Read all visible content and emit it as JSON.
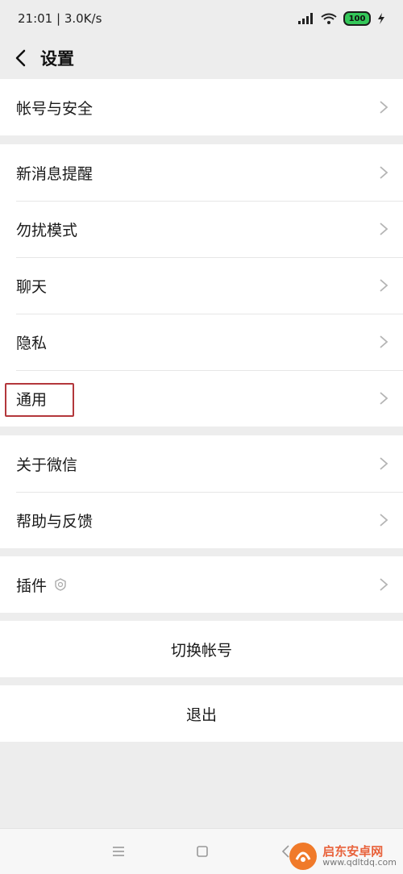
{
  "status": {
    "time_speed": "21:01 | 3.0K/s",
    "battery": "100"
  },
  "header": {
    "title": "设置"
  },
  "groups": [
    {
      "items": [
        {
          "label": "帐号与安全"
        }
      ]
    },
    {
      "items": [
        {
          "label": "新消息提醒"
        },
        {
          "label": "勿扰模式"
        },
        {
          "label": "聊天"
        },
        {
          "label": "隐私"
        },
        {
          "label": "通用"
        }
      ]
    },
    {
      "items": [
        {
          "label": "关于微信"
        },
        {
          "label": "帮助与反馈"
        }
      ]
    },
    {
      "items": [
        {
          "label": "插件"
        }
      ]
    }
  ],
  "actions": {
    "switch_account": "切换帐号",
    "logout": "退出"
  },
  "watermark": {
    "name": "启东安卓网",
    "url": "www.qdltdq.com"
  },
  "colors": {
    "highlight": "#b3373b",
    "battery": "#34c759"
  }
}
